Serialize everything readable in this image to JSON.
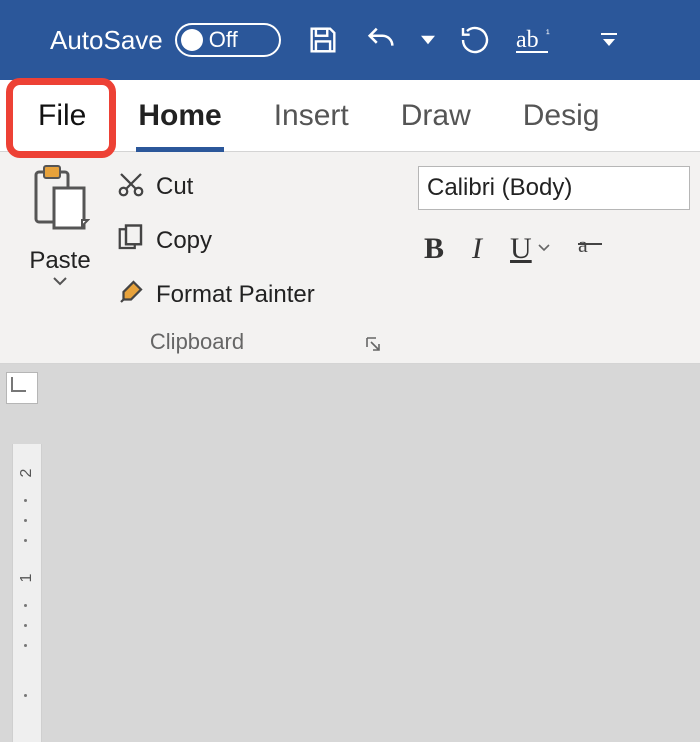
{
  "titlebar": {
    "autosave_label": "AutoSave",
    "autosave_state": "Off"
  },
  "tabs": {
    "file": "File",
    "home": "Home",
    "insert": "Insert",
    "draw": "Draw",
    "design": "Desig"
  },
  "clipboard": {
    "paste": "Paste",
    "cut": "Cut",
    "copy": "Copy",
    "format_painter": "Format Painter",
    "group_label": "Clipboard"
  },
  "font": {
    "name": "Calibri (Body)",
    "bold": "B",
    "italic": "I",
    "underline": "U"
  },
  "ruler": {
    "v2": "2",
    "v1": "1"
  },
  "annotation": {
    "file_tab_highlighted": true
  }
}
